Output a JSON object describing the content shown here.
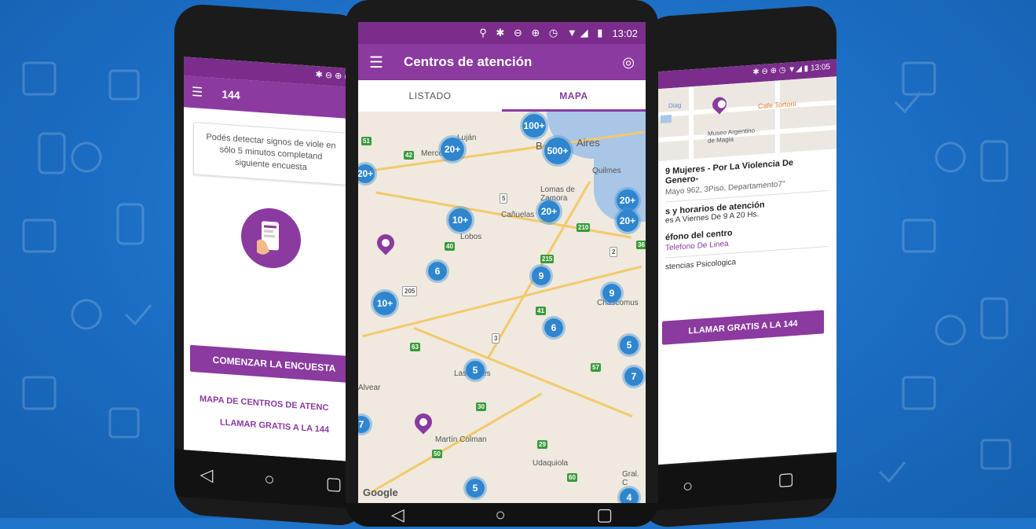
{
  "left_phone": {
    "status_icons": "✱ ⊖ ⊕ ◷",
    "title": "144",
    "survey_text": "Podés detectar signos de viole en sólo 5 minutos completand siguiente encuesta",
    "start_survey": "COMENZAR LA ENCUESTA",
    "map_link": "MAPA DE CENTROS DE ATENC",
    "call_link": "LLAMAR GRATIS A LA 144"
  },
  "center_phone": {
    "status_icons": "⚲ ✱ ⊖ ⊕ ◷ ▼◢ ▮",
    "time": "13:02",
    "title": "Centros de atención",
    "tabs": [
      {
        "label": "LISTADO",
        "active": false
      },
      {
        "label": "MAPA",
        "active": true
      }
    ],
    "map": {
      "labels": [
        "Luján",
        "Merced",
        "Aires",
        "Quilmes",
        "Lomas de Zamora",
        "Cañuelas",
        "Lobos",
        "Alvear",
        "Martín Colman",
        "Udaquiola",
        "Chascomus",
        "Gral. C",
        "Las Flores",
        "B"
      ],
      "clusters": [
        "100+",
        "20+",
        "500+",
        "20+",
        "20+",
        "20+",
        "10+",
        "10+",
        "6",
        "9",
        "9",
        "6",
        "5",
        "5",
        "7",
        "5",
        "20+",
        "4",
        "7"
      ],
      "highways": [
        "51",
        "42",
        "40",
        "210",
        "215",
        "205",
        "41",
        "63",
        "30",
        "29",
        "50",
        "60",
        "57",
        "36",
        "2",
        "3",
        "5"
      ],
      "attribution": "Google"
    }
  },
  "right_phone": {
    "status_icons": "✱ ⊖ ⊕ ◷ ▼◢ ▮",
    "time": "13:05",
    "map_labels": [
      "Cafe Tortoni",
      "Museo Argentino de Magia",
      "Diag"
    ],
    "center_name": "9 Mujeres - Por La Violencia De Genero-",
    "address": "Mayo 962, 3Piso, Departamento7\"",
    "hours_title": "s y horarios de atención",
    "hours": "es A Viernes De 9 A 20 Hs.",
    "phone_title": "éfono del centro",
    "phone_type": "Telefono De Linea",
    "service": "stencias Psicologica",
    "call_button": "LLAMAR GRATIS A LA 144"
  },
  "colors": {
    "primary": "#8b3aa0",
    "status": "#7b2d8c",
    "cluster": "#2f86cf",
    "background": "#1f73c8"
  }
}
